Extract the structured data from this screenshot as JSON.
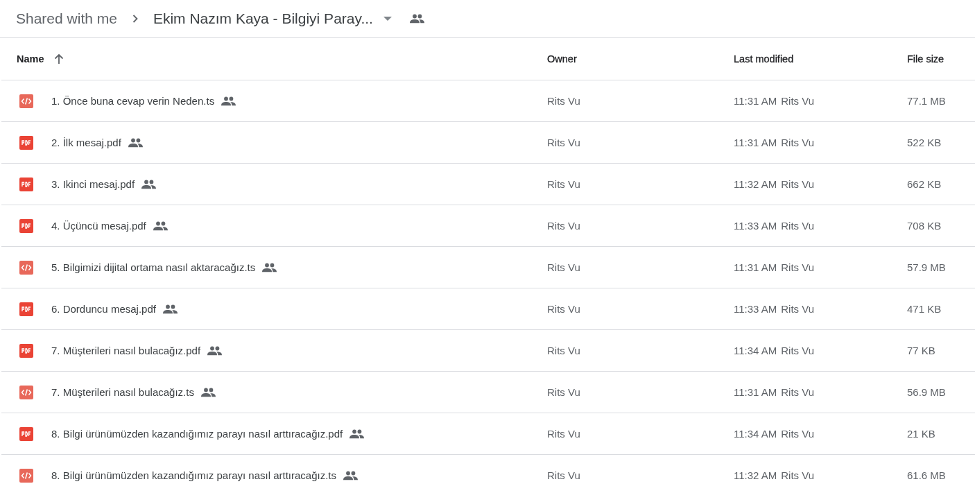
{
  "breadcrumb": {
    "parent": "Shared with me",
    "current": "Ekim Nazım Kaya - Bilgiyi Paray...",
    "shared": true
  },
  "table": {
    "columns": [
      {
        "label": "Name",
        "sorted": true,
        "ascending": true
      },
      {
        "label": "Owner"
      },
      {
        "label": "Last modified"
      },
      {
        "label": "File size"
      }
    ],
    "rows": [
      {
        "kind": "code",
        "name": "1. Önce buna cevap verin Neden.ts",
        "shared": true,
        "owner": "Rits Vu",
        "time": "11:31 AM",
        "modified_by": "Rits Vu",
        "size": "77.1 MB"
      },
      {
        "kind": "pdf",
        "name": "2. İlk mesaj.pdf",
        "shared": true,
        "owner": "Rits Vu",
        "time": "11:31 AM",
        "modified_by": "Rits Vu",
        "size": "522 KB"
      },
      {
        "kind": "pdf",
        "name": "3. Ikinci mesaj.pdf",
        "shared": true,
        "owner": "Rits Vu",
        "time": "11:32 AM",
        "modified_by": "Rits Vu",
        "size": "662 KB"
      },
      {
        "kind": "pdf",
        "name": "4. Üçüncü mesaj.pdf",
        "shared": true,
        "owner": "Rits Vu",
        "time": "11:33 AM",
        "modified_by": "Rits Vu",
        "size": "708 KB"
      },
      {
        "kind": "code",
        "name": "5. Bilgimizi dijital ortama nasıl aktaracağız.ts",
        "shared": true,
        "owner": "Rits Vu",
        "time": "11:31 AM",
        "modified_by": "Rits Vu",
        "size": "57.9 MB"
      },
      {
        "kind": "pdf",
        "name": "6. Dorduncu mesaj.pdf",
        "shared": true,
        "owner": "Rits Vu",
        "time": "11:33 AM",
        "modified_by": "Rits Vu",
        "size": "471 KB"
      },
      {
        "kind": "pdf",
        "name": "7. Müşterileri nasıl bulacağız.pdf",
        "shared": true,
        "owner": "Rits Vu",
        "time": "11:34 AM",
        "modified_by": "Rits Vu",
        "size": "77 KB"
      },
      {
        "kind": "code",
        "name": "7. Müşterileri nasıl bulacağız.ts",
        "shared": true,
        "owner": "Rits Vu",
        "time": "11:31 AM",
        "modified_by": "Rits Vu",
        "size": "56.9 MB"
      },
      {
        "kind": "pdf",
        "name": "8. Bilgi ürünümüzden kazandığımız parayı nasıl arttıracağız.pdf",
        "shared": true,
        "owner": "Rits Vu",
        "time": "11:34 AM",
        "modified_by": "Rits Vu",
        "size": "21 KB"
      },
      {
        "kind": "code",
        "name": "8. Bilgi ürünümüzden kazandığımız parayı nasıl arttıracağız.ts",
        "shared": true,
        "owner": "Rits Vu",
        "time": "11:32 AM",
        "modified_by": "Rits Vu",
        "size": "61.6 MB"
      }
    ]
  }
}
